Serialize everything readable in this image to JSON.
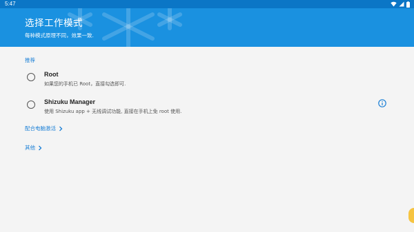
{
  "status_bar": {
    "time": "5:47"
  },
  "header": {
    "title": "选择工作模式",
    "subtitle": "每种模式原理不同，效果一致."
  },
  "sections": {
    "recommended_label": "推荐"
  },
  "options": [
    {
      "title": "Root",
      "description": "如果您的手机已 Root，直接勾选即可."
    },
    {
      "title": "Shizuku Manager",
      "description": "使用 Shizuku app + 无线调试功能, 直接在手机上免 root 使用."
    }
  ],
  "links": {
    "pc_activation": "配合电脑激活",
    "other": "其他"
  },
  "colors": {
    "header": "#1a91e0",
    "status_bar": "#0b76c6",
    "accent": "#1a7fd6",
    "background": "#f4f4f4"
  }
}
